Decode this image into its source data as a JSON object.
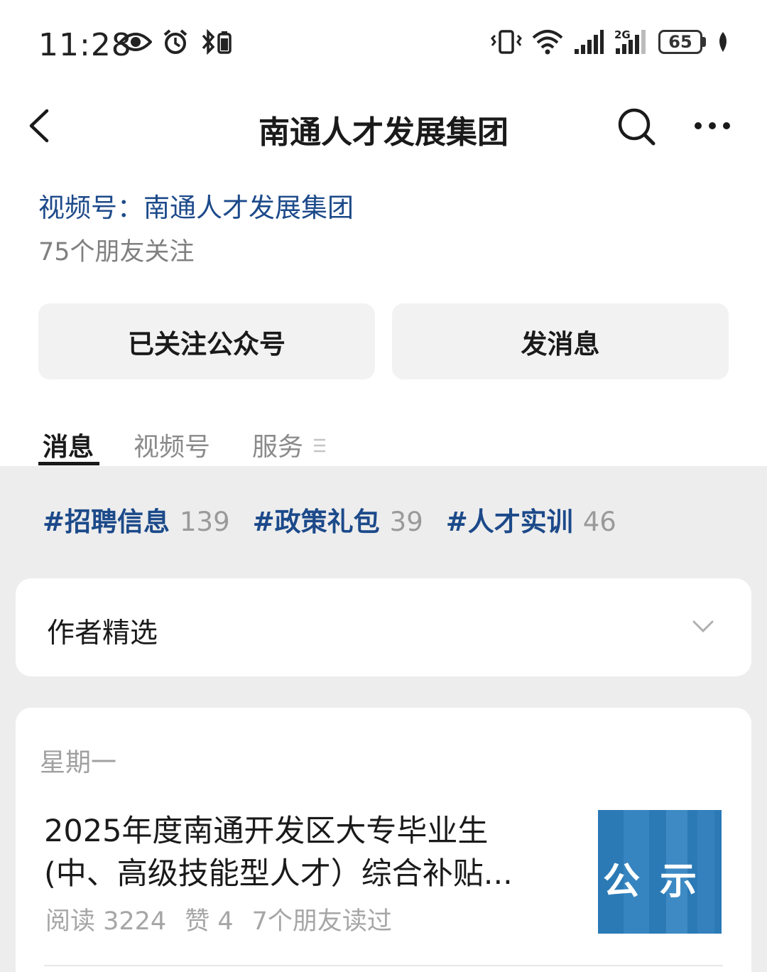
{
  "status_bar": {
    "time": "11:28",
    "battery": "65",
    "network": "2G",
    "icons": [
      "eye-icon",
      "alarm-icon",
      "bluetooth-icon",
      "vibrate-icon",
      "wifi-icon",
      "signal-icon",
      "signal-2g-icon",
      "battery-icon",
      "leaf-icon"
    ]
  },
  "nav": {
    "title": "南通人才发展集团"
  },
  "profile": {
    "channel": "视频号：南通人才发展集团",
    "followers": "75个朋友关注",
    "follow_button": "已关注公众号",
    "message_button": "发消息"
  },
  "tabs": [
    {
      "label": "消息",
      "active": true
    },
    {
      "label": "视频号",
      "active": false
    },
    {
      "label": "服务",
      "active": false
    }
  ],
  "hashtags": [
    {
      "name": "#招聘信息",
      "count": "139"
    },
    {
      "name": "#政策礼包",
      "count": "39"
    },
    {
      "name": "#人才实训",
      "count": "46"
    }
  ],
  "author_select": {
    "title": "作者精选"
  },
  "article": {
    "day": "星期一",
    "title_line1": "2025年度南通开发区大专毕业生",
    "title_line2": "(中、高级技能型人才）综合补贴...",
    "reads": "阅读 3224",
    "likes": "赞 4",
    "friends": "7个朋友读过",
    "thumb_text": "公示"
  },
  "colors": {
    "link_blue": "#1c4a8a",
    "grey_bg": "#ededed",
    "thumb_blue": "#2b7ab6"
  }
}
